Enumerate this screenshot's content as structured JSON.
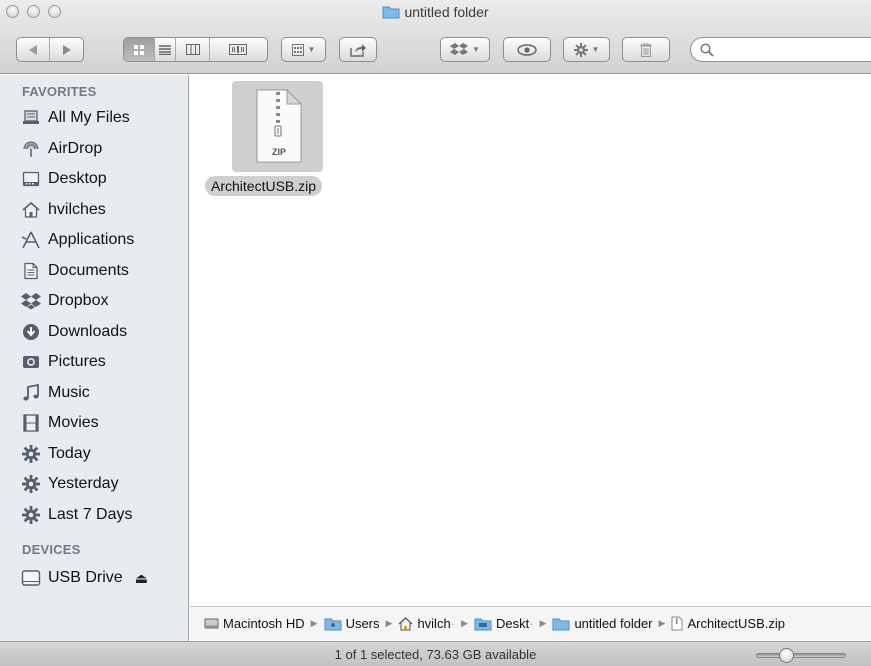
{
  "window": {
    "title": "untitled folder"
  },
  "toolbar": {
    "back_icon": "back-arrow-icon",
    "forward_icon": "forward-arrow-icon",
    "view_modes": [
      "icon-view",
      "list-view",
      "column-view",
      "cover-flow-view"
    ],
    "active_view": "icon-view",
    "search_placeholder": ""
  },
  "sidebar": {
    "favorites_header": "FAVORITES",
    "favorites": [
      {
        "label": "All My Files",
        "icon": "all-files-icon"
      },
      {
        "label": "AirDrop",
        "icon": "airdrop-icon"
      },
      {
        "label": "Desktop",
        "icon": "desktop-icon"
      },
      {
        "label": "hvilches",
        "icon": "home-icon"
      },
      {
        "label": "Applications",
        "icon": "applications-icon"
      },
      {
        "label": "Documents",
        "icon": "documents-icon"
      },
      {
        "label": "Dropbox",
        "icon": "dropbox-icon"
      },
      {
        "label": "Downloads",
        "icon": "downloads-icon"
      },
      {
        "label": "Pictures",
        "icon": "pictures-icon"
      },
      {
        "label": "Music",
        "icon": "music-icon"
      },
      {
        "label": "Movies",
        "icon": "movies-icon"
      },
      {
        "label": "Today",
        "icon": "smart-folder-icon"
      },
      {
        "label": "Yesterday",
        "icon": "smart-folder-icon"
      },
      {
        "label": "Last 7 Days",
        "icon": "smart-folder-icon"
      }
    ],
    "devices_header": "DEVICES",
    "devices": [
      {
        "label": "USB Drive",
        "icon": "drive-icon",
        "eject": "⏏"
      }
    ]
  },
  "content": {
    "files": [
      {
        "name": "ArchitectUSB.zip",
        "badge": "ZIP",
        "selected": true
      }
    ]
  },
  "pathbar": {
    "crumbs": [
      "Macintosh HD",
      "Users",
      "hvilch",
      "Deskt",
      "untitled folder",
      "ArchitectUSB.zip"
    ]
  },
  "status": {
    "text": "1 of 1 selected, 73.63 GB available",
    "zoom_level": 0.3
  },
  "colors": {
    "sidebar_bg": "#e8ecf1",
    "selection_gray": "#cfcfcf",
    "section_header": "#6f7987"
  }
}
